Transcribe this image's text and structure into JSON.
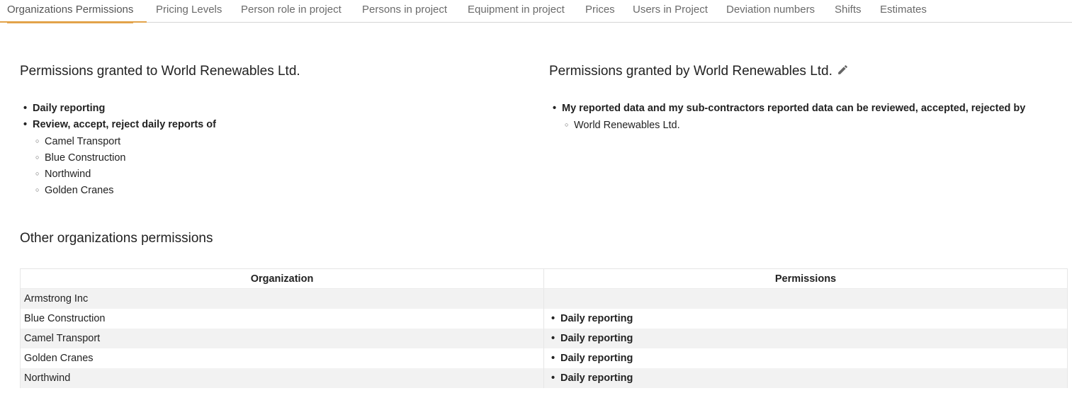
{
  "tabs": [
    {
      "label": "Organizations Permissions",
      "active": true
    },
    {
      "label": "Pricing Levels"
    },
    {
      "label": "Person role in project"
    },
    {
      "label": "Persons in project"
    },
    {
      "label": "Equipment in project"
    },
    {
      "label": "Prices"
    },
    {
      "label": "Users in Project"
    },
    {
      "label": "Deviation numbers"
    },
    {
      "label": "Shifts"
    },
    {
      "label": "Estimates"
    }
  ],
  "granted_to": {
    "title": "Permissions granted to World Renewables Ltd.",
    "items": [
      {
        "label": "Daily reporting"
      },
      {
        "label": "Review, accept, reject daily reports of",
        "children": [
          "Camel Transport",
          "Blue Construction",
          "Northwind",
          "Golden Cranes"
        ]
      }
    ]
  },
  "granted_by": {
    "title": "Permissions granted by World Renewables Ltd.",
    "edit_icon": "pencil-icon",
    "items": [
      {
        "label": "My reported data and my sub-contractors reported data can be reviewed, accepted, rejected by",
        "children": [
          "World Renewables Ltd."
        ]
      }
    ]
  },
  "other": {
    "title": "Other organizations permissions",
    "columns": [
      "Organization",
      "Permissions"
    ],
    "rows": [
      {
        "organization": "Armstrong Inc",
        "permissions": ""
      },
      {
        "organization": "Blue Construction",
        "permissions": "Daily reporting"
      },
      {
        "organization": "Camel Transport",
        "permissions": "Daily reporting"
      },
      {
        "organization": "Golden Cranes",
        "permissions": "Daily reporting"
      },
      {
        "organization": "Northwind",
        "permissions": "Daily reporting"
      }
    ]
  },
  "colors": {
    "accent": "#e2a34a",
    "row_alt": "#f2f2f2"
  }
}
